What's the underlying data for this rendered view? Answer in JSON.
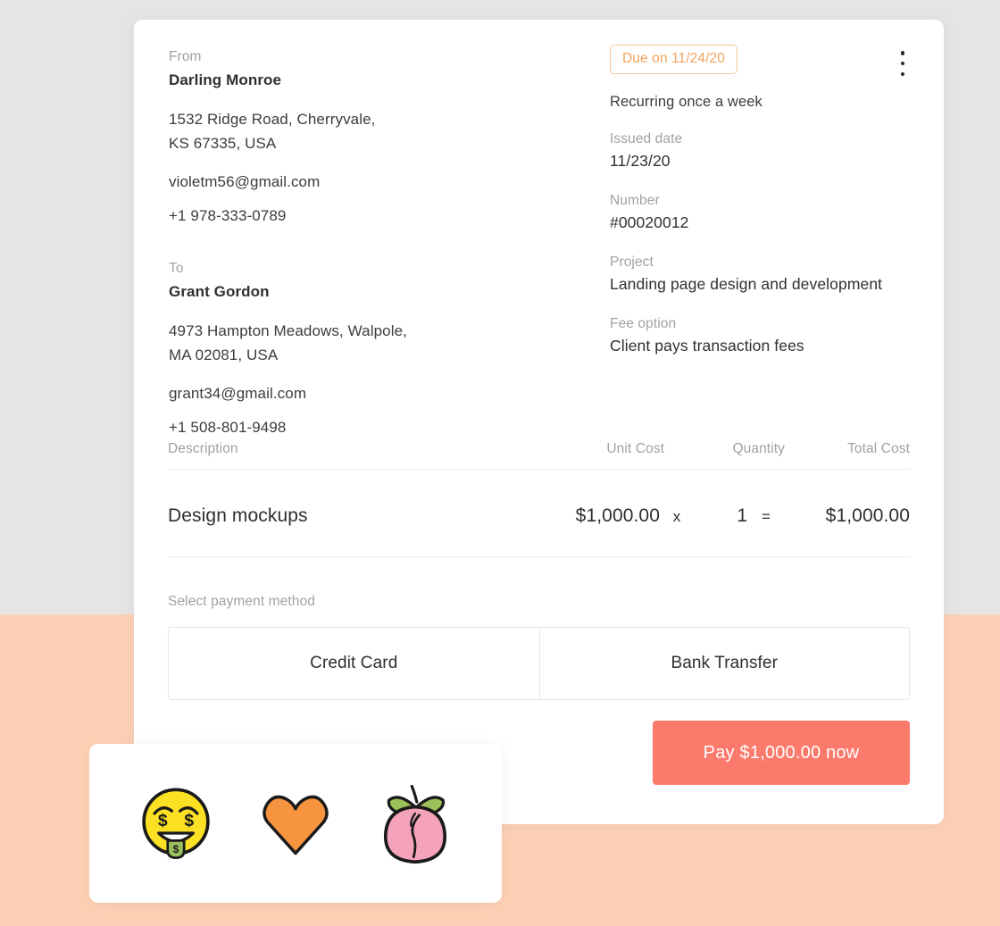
{
  "background": {
    "top_color": "#e6e5e5",
    "bottom_color": "#fdd1b5"
  },
  "invoice": {
    "from": {
      "label": "From",
      "name": "Darling Monroe",
      "address_line_1": "1532 Ridge Road, Cherryvale,",
      "address_line_2": "KS 67335, USA",
      "email": "violetm56@gmail.com",
      "phone": "+1 978-333-0789"
    },
    "to": {
      "label": "To",
      "name": "Grant Gordon",
      "address_line_1": "4973 Hampton Meadows, Walpole,",
      "address_line_2": "MA 02081, USA",
      "email": "grant34@gmail.com",
      "phone": "+1 508-801-9498"
    },
    "meta": {
      "due_badge": "Due on 11/24/20",
      "due_badge_color": "#f0a45c",
      "recurring": "Recurring once a week",
      "issued_date_label": "Issued date",
      "issued_date_value": "11/23/20",
      "number_label": "Number",
      "number_value": "#00020012",
      "project_label": "Project",
      "project_value": "Landing page design and development",
      "fee_option_label": "Fee option",
      "fee_option_value": "Client pays transaction fees"
    },
    "menu_icon": "kebab-menu-icon",
    "table": {
      "headers": {
        "description": "Description",
        "unit_cost": "Unit Cost",
        "quantity": "Quantity",
        "total_cost": "Total Cost"
      },
      "rows": [
        {
          "description": "Design mockups",
          "unit_cost": "$1,000.00",
          "multiply_symbol": "x",
          "quantity": "1",
          "equals_symbol": "=",
          "total_cost": "$1,000.00"
        }
      ]
    },
    "payment": {
      "label": "Select payment method",
      "options": [
        {
          "label": "Credit Card"
        },
        {
          "label": "Bank Transfer"
        }
      ],
      "pay_button": "Pay $1,000.00 now",
      "pay_button_color": "#fb7a6c"
    }
  },
  "emoji_card": {
    "emojis": [
      {
        "name": "money-mouth-face-emoji",
        "colors": {
          "face": "#fbe023",
          "tongue": "#9bbf5e",
          "outline": "#1a1a1a"
        }
      },
      {
        "name": "orange-heart-emoji",
        "colors": {
          "fill": "#f79440",
          "outline": "#1a1a1a"
        }
      },
      {
        "name": "peach-emoji",
        "colors": {
          "fruit": "#f4a3bb",
          "leaf": "#9dbf5a",
          "outline": "#1a1a1a"
        }
      }
    ]
  }
}
